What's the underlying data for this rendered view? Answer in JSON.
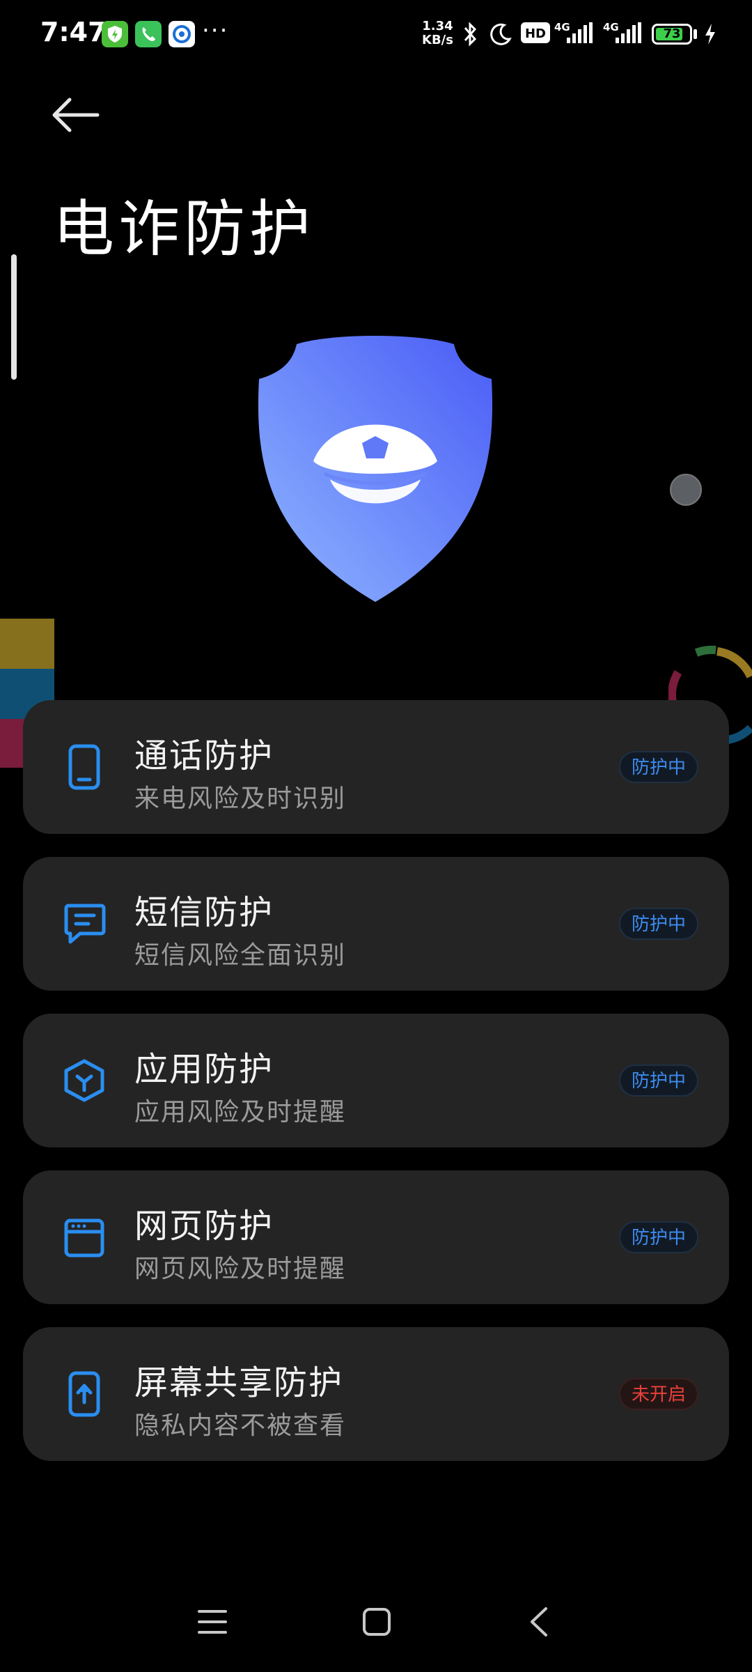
{
  "status_bar": {
    "time": "7:47",
    "more_dots": "···",
    "net_speed_value": "1.34",
    "net_speed_unit": "KB/s",
    "hd_label": "HD",
    "signal1_label": "4G",
    "signal2_label": "4G",
    "battery_level": "73",
    "battery_color": "#3ecf4a"
  },
  "header": {
    "title": "电诈防护"
  },
  "colors": {
    "accent": "#2a8ef0",
    "on_badge": "#3d8bf0",
    "off_badge": "#e8413a",
    "card_bg": "#242424",
    "shield_top": "#4a5cf6",
    "shield_bottom": "#8fb6ff"
  },
  "cards": [
    {
      "icon": "phone-icon",
      "title": "通话防护",
      "subtitle": "来电风险及时识别",
      "status": "防护中",
      "status_type": "on"
    },
    {
      "icon": "message-icon",
      "title": "短信防护",
      "subtitle": "短信风险全面识别",
      "status": "防护中",
      "status_type": "on"
    },
    {
      "icon": "app-cube-icon",
      "title": "应用防护",
      "subtitle": "应用风险及时提醒",
      "status": "防护中",
      "status_type": "on"
    },
    {
      "icon": "browser-icon",
      "title": "网页防护",
      "subtitle": "网页风险及时提醒",
      "status": "防护中",
      "status_type": "on"
    },
    {
      "icon": "screen-share-icon",
      "title": "屏幕共享防护",
      "subtitle": "隐私内容不被查看",
      "status": "未开启",
      "status_type": "off"
    }
  ],
  "nav_bar": {
    "icons": [
      "menu-icon",
      "home-icon",
      "back-icon"
    ]
  }
}
